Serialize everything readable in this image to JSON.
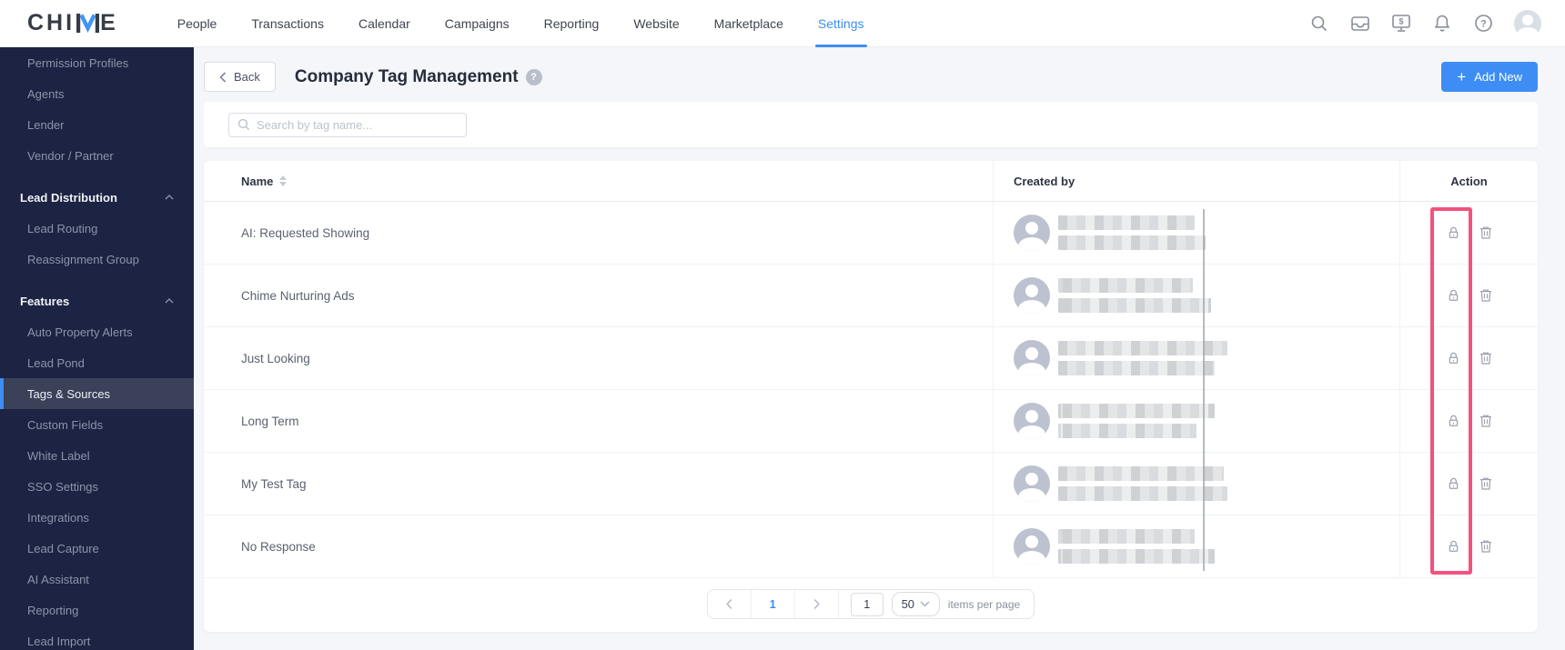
{
  "navbar": {
    "logo": "CHIME",
    "items": [
      {
        "label": "People",
        "active": false
      },
      {
        "label": "Transactions",
        "active": false
      },
      {
        "label": "Calendar",
        "active": false
      },
      {
        "label": "Campaigns",
        "active": false
      },
      {
        "label": "Reporting",
        "active": false
      },
      {
        "label": "Website",
        "active": false
      },
      {
        "label": "Marketplace",
        "active": false
      },
      {
        "label": "Settings",
        "active": true
      }
    ],
    "icons": [
      "search",
      "inbox",
      "billing",
      "notifications",
      "help",
      "avatar"
    ]
  },
  "sidebar": {
    "items": [
      {
        "type": "link",
        "label": "Permission Profiles",
        "active": false
      },
      {
        "type": "link",
        "label": "Agents",
        "active": false
      },
      {
        "type": "link",
        "label": "Lender",
        "active": false
      },
      {
        "type": "link",
        "label": "Vendor / Partner",
        "active": false
      },
      {
        "type": "section",
        "label": "Lead Distribution"
      },
      {
        "type": "link",
        "label": "Lead Routing",
        "active": false
      },
      {
        "type": "link",
        "label": "Reassignment Group",
        "active": false
      },
      {
        "type": "section",
        "label": "Features"
      },
      {
        "type": "link",
        "label": "Auto Property Alerts",
        "active": false
      },
      {
        "type": "link",
        "label": "Lead Pond",
        "active": false
      },
      {
        "type": "link",
        "label": "Tags & Sources",
        "active": true
      },
      {
        "type": "link",
        "label": "Custom Fields",
        "active": false
      },
      {
        "type": "link",
        "label": "White Label",
        "active": false
      },
      {
        "type": "link",
        "label": "SSO Settings",
        "active": false
      },
      {
        "type": "link",
        "label": "Integrations",
        "active": false
      },
      {
        "type": "link",
        "label": "Lead Capture",
        "active": false
      },
      {
        "type": "link",
        "label": "AI Assistant",
        "active": false
      },
      {
        "type": "link",
        "label": "Reporting",
        "active": false
      },
      {
        "type": "link",
        "label": "Lead Import",
        "active": false
      }
    ]
  },
  "page": {
    "back_label": "Back",
    "title": "Company Tag Management",
    "help_glyph": "?",
    "add_new_label": "Add New",
    "add_new_plus": "+"
  },
  "search": {
    "placeholder": "Search by tag name..."
  },
  "table": {
    "columns": [
      {
        "label": "Name",
        "sortable": true
      },
      {
        "label": "Created by",
        "sortable": false
      },
      {
        "label": "Action",
        "sortable": false
      }
    ],
    "rows": [
      {
        "name": "AI: Requested Showing",
        "created_by_redacted": true,
        "blur_widths": [
          150,
          162
        ],
        "actions": [
          "lock",
          "delete"
        ]
      },
      {
        "name": "Chime Nurturing Ads",
        "created_by_redacted": true,
        "blur_widths": [
          148,
          168
        ],
        "actions": [
          "lock",
          "delete"
        ]
      },
      {
        "name": "Just Looking",
        "created_by_redacted": true,
        "blur_widths": [
          186,
          172
        ],
        "actions": [
          "lock",
          "delete"
        ]
      },
      {
        "name": "Long Term",
        "created_by_redacted": true,
        "blur_widths": [
          172,
          152
        ],
        "actions": [
          "lock",
          "delete"
        ]
      },
      {
        "name": "My Test Tag",
        "created_by_redacted": true,
        "blur_widths": [
          182,
          186
        ],
        "actions": [
          "lock",
          "delete"
        ]
      },
      {
        "name": "No Response",
        "created_by_redacted": true,
        "blur_widths": [
          150,
          172
        ],
        "actions": [
          "lock",
          "delete"
        ]
      }
    ]
  },
  "pagination": {
    "current_page": "1",
    "page_input": "1",
    "per_page": "50",
    "per_page_label": "items per page"
  },
  "colors": {
    "accent": "#3d8df5",
    "highlight_pink": "#f4517e",
    "sidebar_bg": "#1d2342"
  }
}
